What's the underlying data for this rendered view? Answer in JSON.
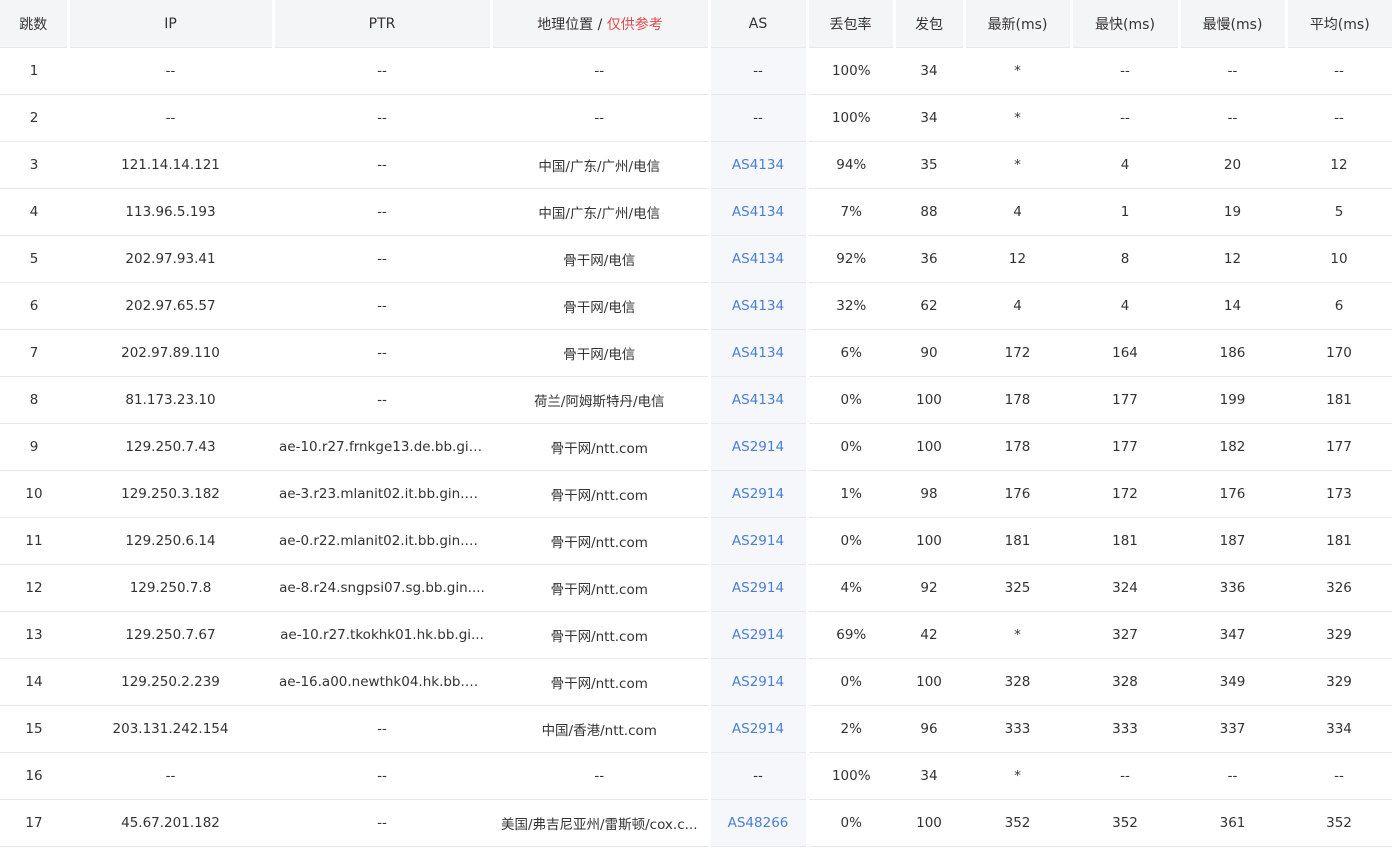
{
  "header": {
    "hop": "跳数",
    "ip": "IP",
    "ptr": "PTR",
    "geo_label": "地理位置",
    "geo_sep": " / ",
    "geo_note": "仅供参考",
    "as": "AS",
    "loss": "丢包率",
    "sent": "发包",
    "last": "最新(ms)",
    "best": "最快(ms)",
    "worst": "最慢(ms)",
    "avg": "平均(ms)"
  },
  "colors": {
    "as_link": "#4a7fd6",
    "geo_note": "#e04b4b",
    "header_bg": "#f4f5f7",
    "as_cell_bg": "#f5f7fa"
  },
  "rows": [
    {
      "hop": "1",
      "ip": "--",
      "ptr": "--",
      "geo": "--",
      "as": "--",
      "loss": "100%",
      "sent": "34",
      "last": "*",
      "best": "--",
      "worst": "--",
      "avg": "--"
    },
    {
      "hop": "2",
      "ip": "--",
      "ptr": "--",
      "geo": "--",
      "as": "--",
      "loss": "100%",
      "sent": "34",
      "last": "*",
      "best": "--",
      "worst": "--",
      "avg": "--"
    },
    {
      "hop": "3",
      "ip": "121.14.14.121",
      "ptr": "--",
      "geo": "中国/广东/广州/电信",
      "as": "AS4134",
      "loss": "94%",
      "sent": "35",
      "last": "*",
      "best": "4",
      "worst": "20",
      "avg": "12"
    },
    {
      "hop": "4",
      "ip": "113.96.5.193",
      "ptr": "--",
      "geo": "中国/广东/广州/电信",
      "as": "AS4134",
      "loss": "7%",
      "sent": "88",
      "last": "4",
      "best": "1",
      "worst": "19",
      "avg": "5"
    },
    {
      "hop": "5",
      "ip": "202.97.93.41",
      "ptr": "--",
      "geo": "骨干网/电信",
      "as": "AS4134",
      "loss": "92%",
      "sent": "36",
      "last": "12",
      "best": "8",
      "worst": "12",
      "avg": "10"
    },
    {
      "hop": "6",
      "ip": "202.97.65.57",
      "ptr": "--",
      "geo": "骨干网/电信",
      "as": "AS4134",
      "loss": "32%",
      "sent": "62",
      "last": "4",
      "best": "4",
      "worst": "14",
      "avg": "6"
    },
    {
      "hop": "7",
      "ip": "202.97.89.110",
      "ptr": "--",
      "geo": "骨干网/电信",
      "as": "AS4134",
      "loss": "6%",
      "sent": "90",
      "last": "172",
      "best": "164",
      "worst": "186",
      "avg": "170"
    },
    {
      "hop": "8",
      "ip": "81.173.23.10",
      "ptr": "--",
      "geo": "荷兰/阿姆斯特丹/电信",
      "as": "AS4134",
      "loss": "0%",
      "sent": "100",
      "last": "178",
      "best": "177",
      "worst": "199",
      "avg": "181"
    },
    {
      "hop": "9",
      "ip": "129.250.7.43",
      "ptr": "ae-10.r27.frnkge13.de.bb.gin...",
      "geo": "骨干网/ntt.com",
      "as": "AS2914",
      "loss": "0%",
      "sent": "100",
      "last": "178",
      "best": "177",
      "worst": "182",
      "avg": "177"
    },
    {
      "hop": "10",
      "ip": "129.250.3.182",
      "ptr": "ae-3.r23.mlanit02.it.bb.gin.nt...",
      "geo": "骨干网/ntt.com",
      "as": "AS2914",
      "loss": "1%",
      "sent": "98",
      "last": "176",
      "best": "172",
      "worst": "176",
      "avg": "173"
    },
    {
      "hop": "11",
      "ip": "129.250.6.14",
      "ptr": "ae-0.r22.mlanit02.it.bb.gin.nt...",
      "geo": "骨干网/ntt.com",
      "as": "AS2914",
      "loss": "0%",
      "sent": "100",
      "last": "181",
      "best": "181",
      "worst": "187",
      "avg": "181"
    },
    {
      "hop": "12",
      "ip": "129.250.7.8",
      "ptr": "ae-8.r24.sngpsi07.sg.bb.gin....",
      "geo": "骨干网/ntt.com",
      "as": "AS2914",
      "loss": "4%",
      "sent": "92",
      "last": "325",
      "best": "324",
      "worst": "336",
      "avg": "326"
    },
    {
      "hop": "13",
      "ip": "129.250.7.67",
      "ptr": "ae-10.r27.tkokhk01.hk.bb.gi...",
      "geo": "骨干网/ntt.com",
      "as": "AS2914",
      "loss": "69%",
      "sent": "42",
      "last": "*",
      "best": "327",
      "worst": "347",
      "avg": "329"
    },
    {
      "hop": "14",
      "ip": "129.250.2.239",
      "ptr": "ae-16.a00.newthk04.hk.bb.gi...",
      "geo": "骨干网/ntt.com",
      "as": "AS2914",
      "loss": "0%",
      "sent": "100",
      "last": "328",
      "best": "328",
      "worst": "349",
      "avg": "329"
    },
    {
      "hop": "15",
      "ip": "203.131.242.154",
      "ptr": "--",
      "geo": "中国/香港/ntt.com",
      "as": "AS2914",
      "loss": "2%",
      "sent": "96",
      "last": "333",
      "best": "333",
      "worst": "337",
      "avg": "334"
    },
    {
      "hop": "16",
      "ip": "--",
      "ptr": "--",
      "geo": "--",
      "as": "--",
      "loss": "100%",
      "sent": "34",
      "last": "*",
      "best": "--",
      "worst": "--",
      "avg": "--"
    },
    {
      "hop": "17",
      "ip": "45.67.201.182",
      "ptr": "--",
      "geo": "美国/弗吉尼亚州/雷斯顿/cox.c...",
      "as": "AS48266",
      "loss": "0%",
      "sent": "100",
      "last": "352",
      "best": "352",
      "worst": "361",
      "avg": "352"
    }
  ]
}
